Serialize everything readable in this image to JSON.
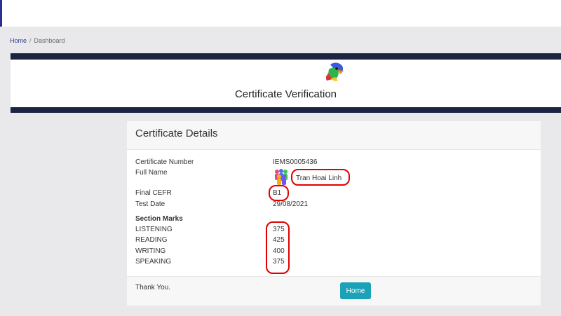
{
  "breadcrumb": {
    "home": "Home",
    "separator": "/",
    "current": "Dashboard"
  },
  "banner": {
    "title": "Certificate Verification",
    "logo_icon": "parrot-logo-icon"
  },
  "card": {
    "title": "Certificate Details",
    "rows": {
      "certificate_number": {
        "label": "Certificate Number",
        "value": "IEMS0005436"
      },
      "full_name": {
        "label": "Full Name",
        "value": "Tran Hoai Linh"
      },
      "final_cefr": {
        "label": "Final CEFR",
        "value": "B1"
      },
      "test_date": {
        "label": "Test Date",
        "value": "29/08/2021"
      }
    },
    "section_marks": {
      "heading": "Section Marks",
      "items": [
        {
          "label": "LISTENING",
          "value": "375"
        },
        {
          "label": "READING",
          "value": "425"
        },
        {
          "label": "WRITING",
          "value": "400"
        },
        {
          "label": "SPEAKING",
          "value": "375"
        }
      ]
    },
    "footer": {
      "thanks": "Thank You.",
      "home_button": "Home"
    }
  },
  "colors": {
    "accent": "#1aa2b8",
    "banner_bar": "#1b2440",
    "highlight": "#e00000"
  }
}
